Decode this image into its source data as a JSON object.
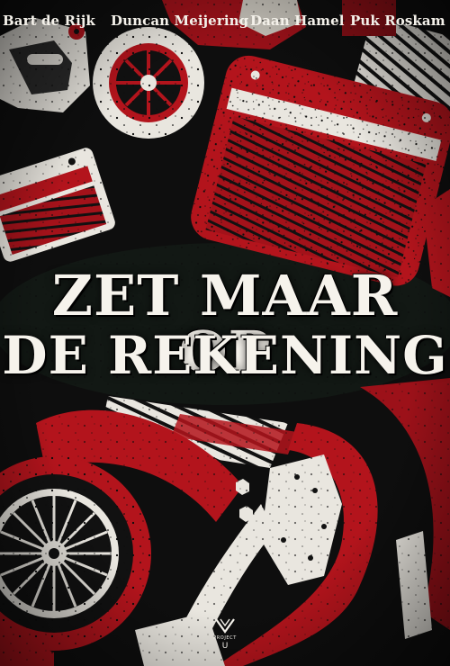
{
  "poster": {
    "authors": [
      "Bart de Rijk",
      "Duncan Meijering",
      "Daan Hamel",
      "Puk Roskam"
    ],
    "title_line1": "ZET MAAR OP",
    "title_line2": "DE REKENING",
    "logo_text": "PROJECT",
    "logo_letter": "U"
  },
  "colors": {
    "background": "#0d0d0d",
    "red": "#b3141c",
    "dark_red": "#7a0c12",
    "cream": "#f4f1ea"
  }
}
